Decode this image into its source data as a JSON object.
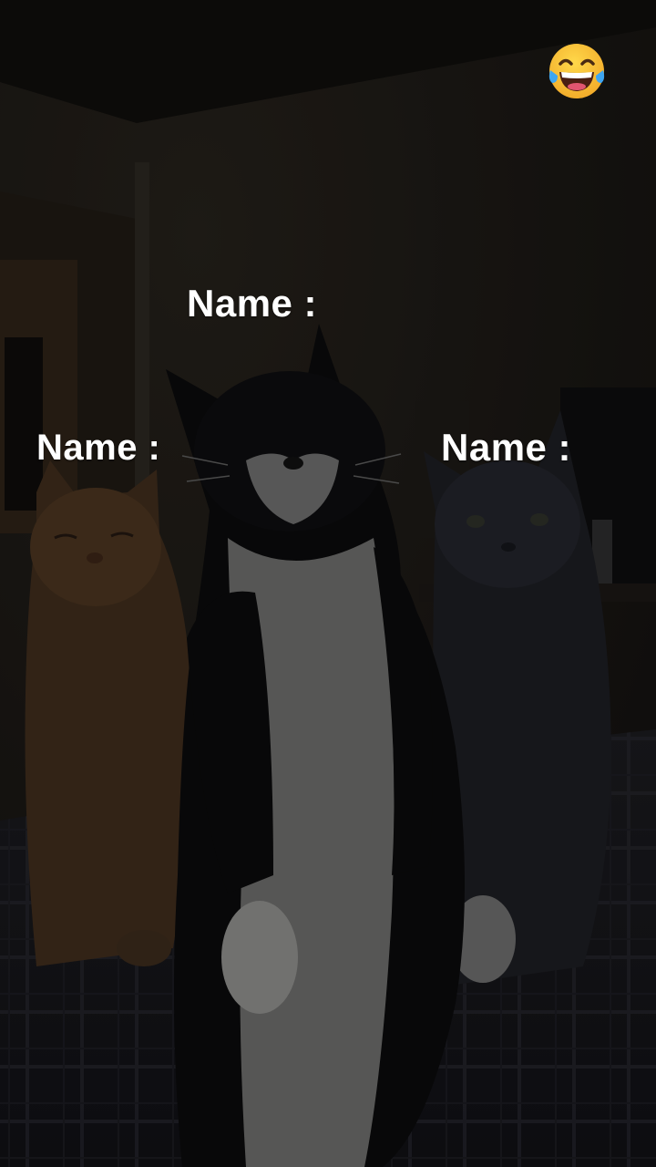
{
  "labels": {
    "top": "Name  :",
    "left": "Name  :",
    "right": "Name  :"
  },
  "emoji": {
    "icon": "face-with-tears-of-joy-icon"
  },
  "colors": {
    "overlay_text": "#ffffff",
    "emoji_face": "#f6c12f",
    "emoji_tears": "#3ea6f2"
  }
}
